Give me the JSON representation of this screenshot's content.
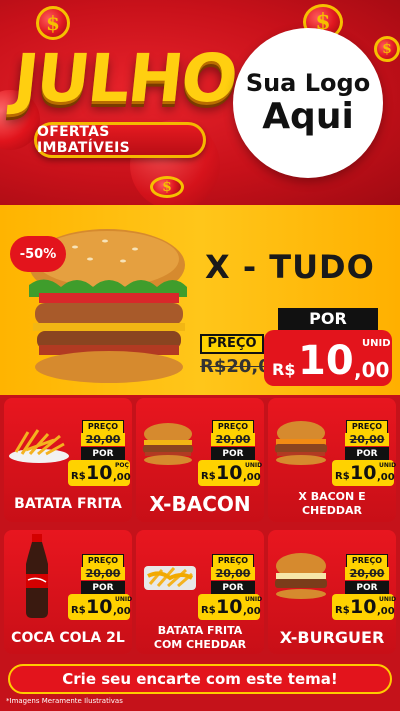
{
  "hero": {
    "title": "JULHO",
    "subtitle": "OFERTAS IMBATÍVEIS",
    "logo_line1": "Sua Logo",
    "logo_line2": "Aqui",
    "coin_symbol": "$"
  },
  "featured": {
    "discount": "-50%",
    "name": "X - TUDO",
    "preco_label": "PREÇO",
    "old_price": "R$20,00",
    "por_label": "POR",
    "currency": "R$",
    "price_int": "10",
    "price_dec": ",00",
    "unit": "UNID"
  },
  "products": [
    {
      "name": "BATATA FRITA",
      "preco_label": "PREÇO",
      "old_price": "20,00",
      "por_label": "POR",
      "currency": "R$",
      "price_int": "10",
      "price_dec": ",00",
      "unit": "POÇ"
    },
    {
      "name": "X-BACON",
      "preco_label": "PREÇO",
      "old_price": "20,00",
      "por_label": "POR",
      "currency": "R$",
      "price_int": "10",
      "price_dec": ",00",
      "unit": "UNID"
    },
    {
      "name": "X BACON E CHEDDAR",
      "preco_label": "PREÇO",
      "old_price": "20,00",
      "por_label": "POR",
      "currency": "R$",
      "price_int": "10",
      "price_dec": ",00",
      "unit": "UNID"
    },
    {
      "name": "COCA COLA 2L",
      "preco_label": "PREÇO",
      "old_price": "20,00",
      "por_label": "POR",
      "currency": "R$",
      "price_int": "10",
      "price_dec": ",00",
      "unit": "UNID"
    },
    {
      "name": "BATATA FRITA COM CHEDDAR",
      "preco_label": "PREÇO",
      "old_price": "20,00",
      "por_label": "POR",
      "currency": "R$",
      "price_int": "10",
      "price_dec": ",00",
      "unit": "UNID"
    },
    {
      "name": "X-BURGUER",
      "preco_label": "PREÇO",
      "old_price": "20,00",
      "por_label": "POR",
      "currency": "R$",
      "price_int": "10",
      "price_dec": ",00",
      "unit": "UNID"
    }
  ],
  "cta": "Crie seu encarte com este tema!",
  "disclaimer": "*Imagens Meramente Ilustrativas",
  "colors": {
    "red": "#e3141c",
    "yellow": "#ffd200",
    "gold": "#f6c000",
    "black": "#111111"
  }
}
